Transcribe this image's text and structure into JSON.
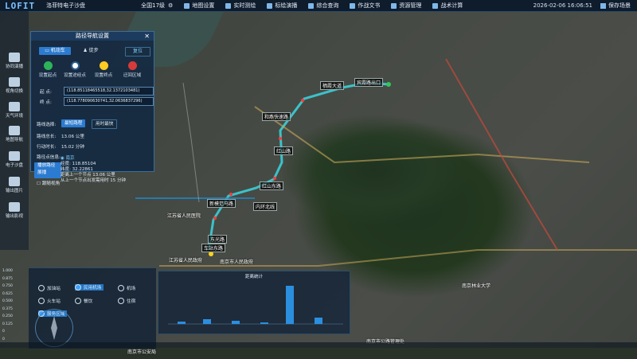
{
  "topbar": {
    "logo": "LOFIT",
    "app_title": "洛菲特电子沙盘",
    "menu": [
      {
        "label": "全国17级",
        "icon": "globe-icon"
      },
      {
        "label": "地图设置",
        "icon": "map-settings-icon"
      },
      {
        "label": "实时测绘",
        "icon": "survey-icon"
      },
      {
        "label": "标绘演播",
        "icon": "plot-icon"
      },
      {
        "label": "综合查询",
        "icon": "query-icon"
      },
      {
        "label": "作战文书",
        "icon": "document-icon"
      },
      {
        "label": "资源管理",
        "icon": "resource-icon"
      },
      {
        "label": "战术计算",
        "icon": "calculator-icon"
      }
    ],
    "datetime": "2026-02-06   16:06:51",
    "save_label": "保存场景"
  },
  "sidebar": {
    "items": [
      {
        "label": "协同演播"
      },
      {
        "label": "视角切换"
      },
      {
        "label": "天气环境"
      },
      {
        "label": "地图导航"
      },
      {
        "label": "电子沙盘"
      },
      {
        "label": "输出图片"
      },
      {
        "label": "输出影视"
      }
    ]
  },
  "nav_panel": {
    "title": "路径导航设置",
    "mode_drive": "机动车",
    "mode_walk": "徒步",
    "mode_reset": "复位",
    "points": [
      "设置起点",
      "设置途经点",
      "设置终点",
      "迂回区域"
    ],
    "start_label": "起 点:",
    "start_value": "(118.85118465518,32.1372103481)",
    "end_label": "终 点:",
    "end_value": "(118.778090630741,32.0636837296)",
    "route_select_label": "路线选择:",
    "route_shortest": "最短路程",
    "route_fastest": "用时最快",
    "distance_label": "路线总长:",
    "distance_value": "13.06 公里",
    "time_label": "行动时长:",
    "time_value": "15.02 分钟",
    "path_info_label": "路径点信息:",
    "path_btn": "播放路径展播",
    "follow_label": "跟随视角",
    "info_lines": [
      "◉ 南京",
      "经度: 118.85104",
      "纬度: 32.22861",
      "距离上一个节点 13.06 公里",
      "从上一个节点出发需用时 15 分钟"
    ]
  },
  "map": {
    "labels": [
      "栖霞大道",
      "宾霞路出口",
      "和燕快速路",
      "红山路",
      "红山东路",
      "内环北线",
      "新模范马路",
      "东光路",
      "车站东路",
      "江苏省人民政府",
      "南京市人民政府",
      "江苏省人民医院",
      "南京市公路管理处",
      "南京林业大学",
      "南京市公安局"
    ]
  },
  "bottom_panel": {
    "options": [
      {
        "label": "加油站",
        "selected": false
      },
      {
        "label": "民用机场",
        "selected": true
      },
      {
        "label": "机场",
        "selected": false
      },
      {
        "label": "火车站",
        "selected": false
      },
      {
        "label": "餐饮",
        "selected": false
      },
      {
        "label": "住宿",
        "selected": false
      },
      {
        "label": "服务区域",
        "selected": true
      }
    ]
  },
  "chart": {
    "title": "距离统计"
  }
}
